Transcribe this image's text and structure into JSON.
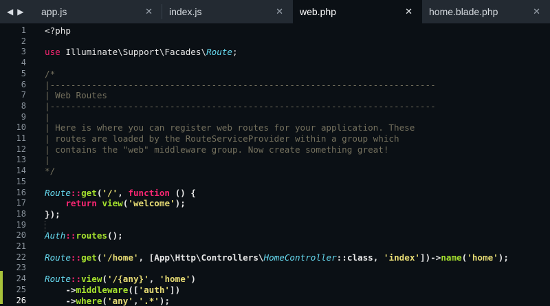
{
  "nav": {
    "back": "◀",
    "forward": "▶"
  },
  "tabs": [
    {
      "label": "app.js",
      "close": "✕"
    },
    {
      "label": "index.js",
      "close": "✕"
    },
    {
      "label": "web.php",
      "close": "✕",
      "active": true
    },
    {
      "label": "home.blade.php",
      "close": "✕"
    }
  ],
  "line_numbers": [
    "1",
    "2",
    "3",
    "4",
    "5",
    "6",
    "7",
    "8",
    "9",
    "10",
    "11",
    "12",
    "13",
    "14",
    "15",
    "16",
    "17",
    "18",
    "19",
    "20",
    "21",
    "22",
    "23",
    "24",
    "25",
    "26"
  ],
  "code": {
    "l1": "<?php",
    "l3": {
      "use": "use",
      "ns": " Illuminate\\Support\\Facades\\",
      "cls": "Route",
      "end": ";"
    },
    "l5": "/*",
    "l6": "|--------------------------------------------------------------------------",
    "l7": "| Web Routes",
    "l8": "|--------------------------------------------------------------------------",
    "l9": "|",
    "l10": "| Here is where you can register web routes for your application. These",
    "l11": "| routes are loaded by the RouteServiceProvider within a group which",
    "l12": "| contains the \"web\" middleware group. Now create something great!",
    "l13": "|",
    "l14": "*/",
    "l16": {
      "cls": "Route",
      "op": "::",
      "fn": "get",
      "p1": "(",
      "s1": "'/'",
      "p2": ", ",
      "kw": "function",
      "p3": " () {"
    },
    "l17": {
      "indent": "    ",
      "kw": "return",
      "sp": " ",
      "fn": "view",
      "p1": "(",
      "s1": "'welcome'",
      "p2": ");"
    },
    "l18": "});",
    "l20": {
      "cls": "Auth",
      "op": "::",
      "fn": "routes",
      "p1": "();"
    },
    "l22": {
      "cls": "Route",
      "op": "::",
      "fn": "get",
      "p1": "(",
      "s1": "'/home'",
      "p2": ", [App\\Http\\Controllers\\",
      "cls2": "HomeController",
      "p3": "::class, ",
      "s2": "'index'",
      "p4": "])->",
      "fn2": "name",
      "p5": "(",
      "s3": "'home'",
      "p6": ");"
    },
    "l24": {
      "cls": "Route",
      "op": "::",
      "fn": "view",
      "p1": "(",
      "s1": "'/{any}'",
      "p2": ", ",
      "s2": "'home'",
      "p3": ")"
    },
    "l25": {
      "indent": "    ->",
      "fn": "middleware",
      "p1": "([",
      "s1": "'auth'",
      "p2": "])"
    },
    "l26": {
      "indent": "    ->",
      "fn": "where",
      "p1": "(",
      "s1": "'any'",
      "p2": ",",
      "s2": "'.*'",
      "p3": ");"
    }
  },
  "colors": {
    "background": "#0b1015",
    "tabbar": "#232a32",
    "keyword": "#f92672",
    "class": "#66d9ef",
    "function": "#a6e22e",
    "string": "#e6db74",
    "comment": "#75715e",
    "modified_marker": "#a8c23a"
  }
}
